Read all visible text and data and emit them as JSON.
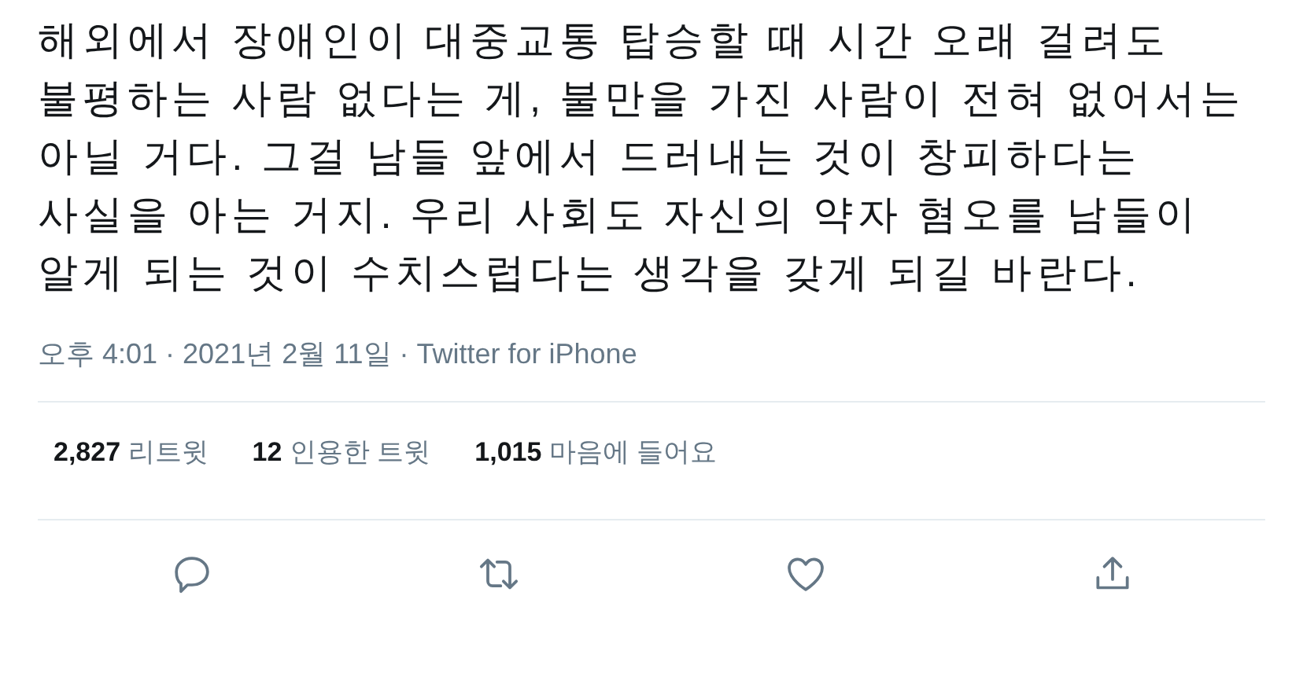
{
  "tweet": {
    "text": "해외에서 장애인이 대중교통 탑승할 때 시간 오래 걸려도 불평하는 사람 없다는 게, 불만을 가진 사람이 전혀 없어서는 아닐 거다. 그걸 남들 앞에서 드러내는 것이 창피하다는 사실을 아는 거지. 우리 사회도 자신의 약자 혐오를 남들이 알게 되는 것이 수치스럽다는 생각을 갖게 되길 바란다.",
    "meta": "오후 4:01 · 2021년 2월 11일 · Twitter for iPhone"
  },
  "stats": [
    {
      "count": "2,827",
      "label": "리트윗"
    },
    {
      "count": "12",
      "label": "인용한 트윗"
    },
    {
      "count": "1,015",
      "label": "마음에 들어요"
    }
  ],
  "actions": [
    {
      "kind": "reply"
    },
    {
      "kind": "retweet"
    },
    {
      "kind": "like"
    },
    {
      "kind": "share"
    }
  ]
}
